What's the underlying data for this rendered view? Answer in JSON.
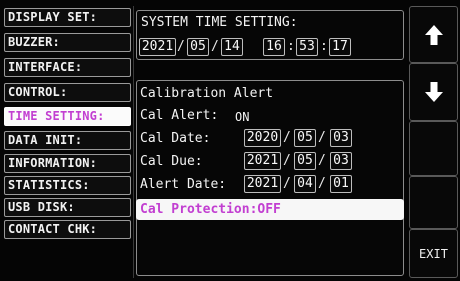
{
  "menu": {
    "items": [
      {
        "label": "DISPLAY SET:"
      },
      {
        "label": "BUZZER:"
      },
      {
        "label": "INTERFACE:"
      },
      {
        "label": "CONTROL:"
      },
      {
        "label": "TIME SETTING:"
      },
      {
        "label": "DATA INIT:"
      },
      {
        "label": "INFORMATION:"
      },
      {
        "label": "STATISTICS:"
      },
      {
        "label": "USB DISK:"
      },
      {
        "label": "CONTACT CHK:"
      }
    ],
    "active_index": 4
  },
  "system_time": {
    "title": "SYSTEM TIME SETTING:",
    "year": "2021",
    "month": "05",
    "day": "14",
    "hour": "16",
    "minute": "53",
    "second": "17"
  },
  "calibration": {
    "title": "Calibration Alert",
    "alert_label": "Cal Alert:",
    "alert_value": "ON",
    "cal_date_label": "Cal Date:",
    "cal_date": {
      "year": "2020",
      "month": "05",
      "day": "03"
    },
    "cal_due_label": "Cal Due:",
    "cal_due": {
      "year": "2021",
      "month": "05",
      "day": "03"
    },
    "alert_date_label": "Alert Date:",
    "alert_date": {
      "year": "2021",
      "month": "04",
      "day": "01"
    },
    "protection_text": "Cal Protection:OFF"
  },
  "sidebar_buttons": {
    "up_icon": "arrow-up-icon",
    "down_icon": "arrow-down-icon",
    "exit_label": "EXIT"
  },
  "colors": {
    "highlight_text": "#c23fd1",
    "highlight_bg": "#fbfbfb"
  }
}
